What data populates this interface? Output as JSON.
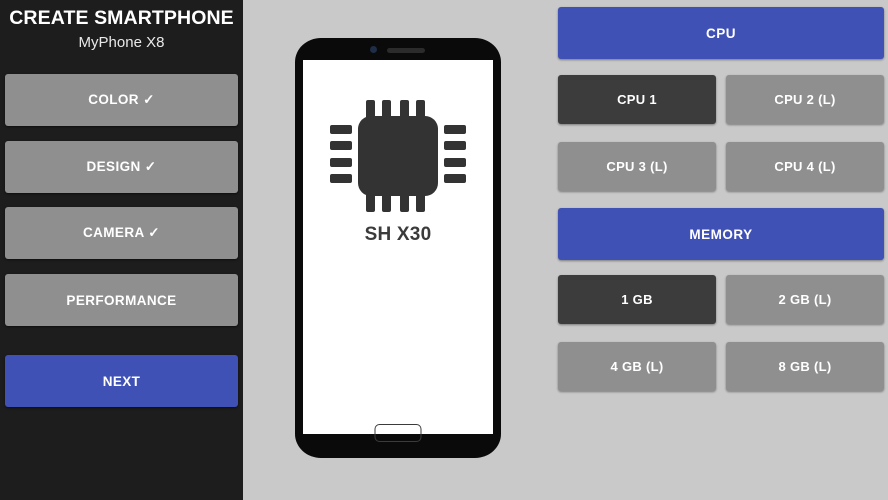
{
  "sidebar": {
    "title": "CREATE SMARTPHONE",
    "model": "MyPhone X8",
    "steps": [
      {
        "label": "COLOR ✓",
        "state": "completed"
      },
      {
        "label": "DESIGN ✓",
        "state": "completed"
      },
      {
        "label": "CAMERA ✓",
        "state": "completed"
      },
      {
        "label": "PERFORMANCE",
        "state": "current"
      }
    ],
    "next_label": "NEXT"
  },
  "phone_preview": {
    "chip_icon": "cpu-chip-icon",
    "chip_label": "SH X30",
    "camera_icon": "front-camera-icon",
    "speaker_icon": "earpiece-speaker-icon",
    "home_button_icon": "home-button-icon"
  },
  "options_panel": {
    "sections": [
      {
        "header": "CPU",
        "options": [
          {
            "label": "CPU 1",
            "state": "selected"
          },
          {
            "label": "CPU 2 (L)",
            "state": "locked"
          },
          {
            "label": "CPU 3 (L)",
            "state": "locked"
          },
          {
            "label": "CPU 4 (L)",
            "state": "locked"
          }
        ]
      },
      {
        "header": "MEMORY",
        "options": [
          {
            "label": "1 GB",
            "state": "selected"
          },
          {
            "label": "2 GB (L)",
            "state": "locked"
          },
          {
            "label": "4 GB (L)",
            "state": "locked"
          },
          {
            "label": "8 GB (L)",
            "state": "locked"
          }
        ]
      }
    ]
  },
  "colors": {
    "sidebar_bg": "#1d1d1d",
    "page_bg": "#c9c9c9",
    "accent_blue": "#3f51b5",
    "button_grey": "#8f8f8f",
    "button_selected": "#3c3c3c",
    "phone_body": "#0a0a0a",
    "chip": "#333333"
  }
}
